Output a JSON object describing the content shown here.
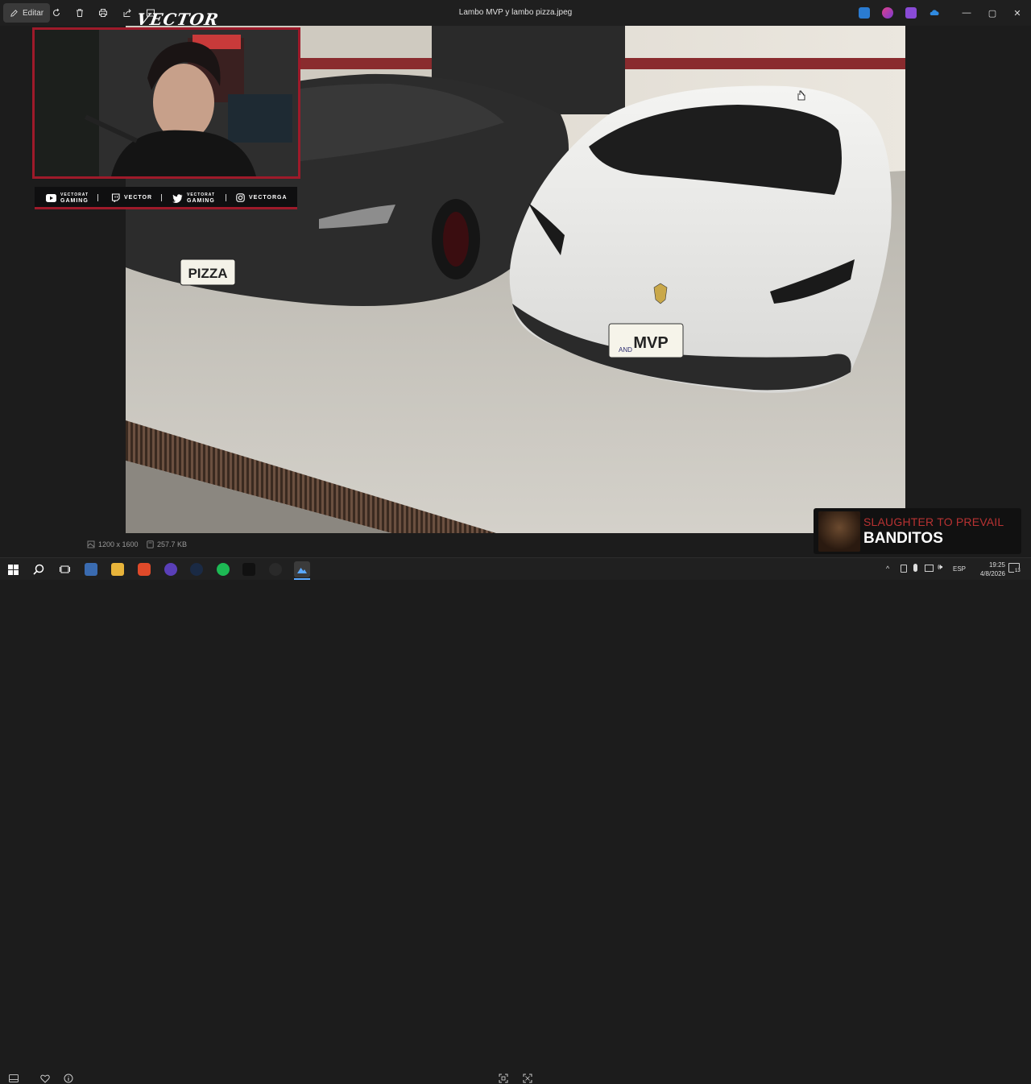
{
  "window": {
    "title": "Lambo MVP y lambo pizza.jpeg",
    "edit_label": "Editar",
    "minimize_glyph": "—",
    "maximize_glyph": "▢",
    "close_glyph": "✕"
  },
  "overlay": {
    "logo": "VECTOR",
    "socials": [
      {
        "icon": "youtube-icon",
        "line1": "VECTORAT",
        "line2": "GAMING"
      },
      {
        "icon": "twitch-icon",
        "line1": "VECTOR",
        "line2": ""
      },
      {
        "icon": "twitter-icon",
        "line1": "VECTORAT",
        "line2": "GAMING"
      },
      {
        "icon": "instagram-icon",
        "line1": "VECTORGA",
        "line2": ""
      }
    ]
  },
  "photo": {
    "plate_left": "PIZZA",
    "plate_right": "MVP",
    "plate_country": "AND"
  },
  "bottombar": {
    "dimensions": "1200 x 1600",
    "filesize": "257.7 KB"
  },
  "now_playing": {
    "artist": "SLAUGHTER TO PREVAIL",
    "track": "BANDITOS"
  },
  "taskbar": {
    "language": "ESP",
    "time": "19:25",
    "date": "4/8/2026",
    "notifications": "13"
  },
  "colors": {
    "accent_red": "#9e1a2a",
    "artist_red": "#b83232"
  }
}
